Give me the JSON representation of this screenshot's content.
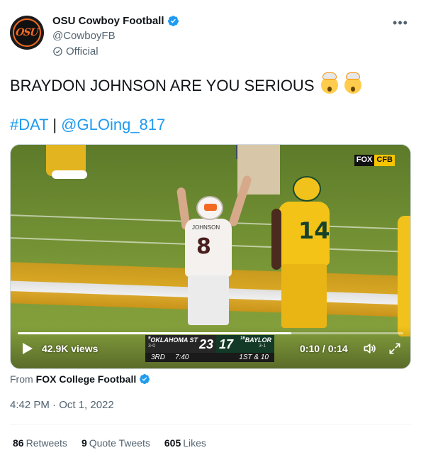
{
  "author": {
    "display_name": "OSU Cowboy Football",
    "handle": "@CowboyFB",
    "label": "Official",
    "avatar_text": "OSU"
  },
  "tweet": {
    "text": "BRAYDON JOHNSON ARE YOU SERIOUS",
    "hashtag": "#DAT",
    "separator": " | ",
    "mention": "@GLOing_817"
  },
  "video": {
    "views": "42.9K views",
    "time": "0:10 / 0:14",
    "progress": 0.71,
    "broadcast_bug": {
      "network": "FOX",
      "tag": "CFB"
    },
    "scorebug": {
      "team1": "OKLAHOMA ST",
      "team1_rank": "9",
      "team1_record": "3-0",
      "team1_score": "23",
      "team2": "BAYLOR",
      "team2_rank": "16",
      "team2_record": "3-1",
      "team2_score": "17",
      "quarter": "3RD",
      "clock": "7:40",
      "down": "1ST & 10"
    },
    "player_numbers": {
      "white": "8",
      "gold": "14"
    },
    "player_name": "JOHNSON"
  },
  "from": {
    "prefix": "From",
    "source": "FOX College Football"
  },
  "timestamp": "4:42 PM · Oct 1, 2022",
  "stats": [
    {
      "count": "86",
      "label": "Retweets"
    },
    {
      "count": "9",
      "label": "Quote Tweets"
    },
    {
      "count": "605",
      "label": "Likes"
    }
  ],
  "colors": {
    "link": "#1d9bf0",
    "verified": "#1d9bf0",
    "secondary_text": "#536471",
    "osu_orange": "#f26a21"
  }
}
